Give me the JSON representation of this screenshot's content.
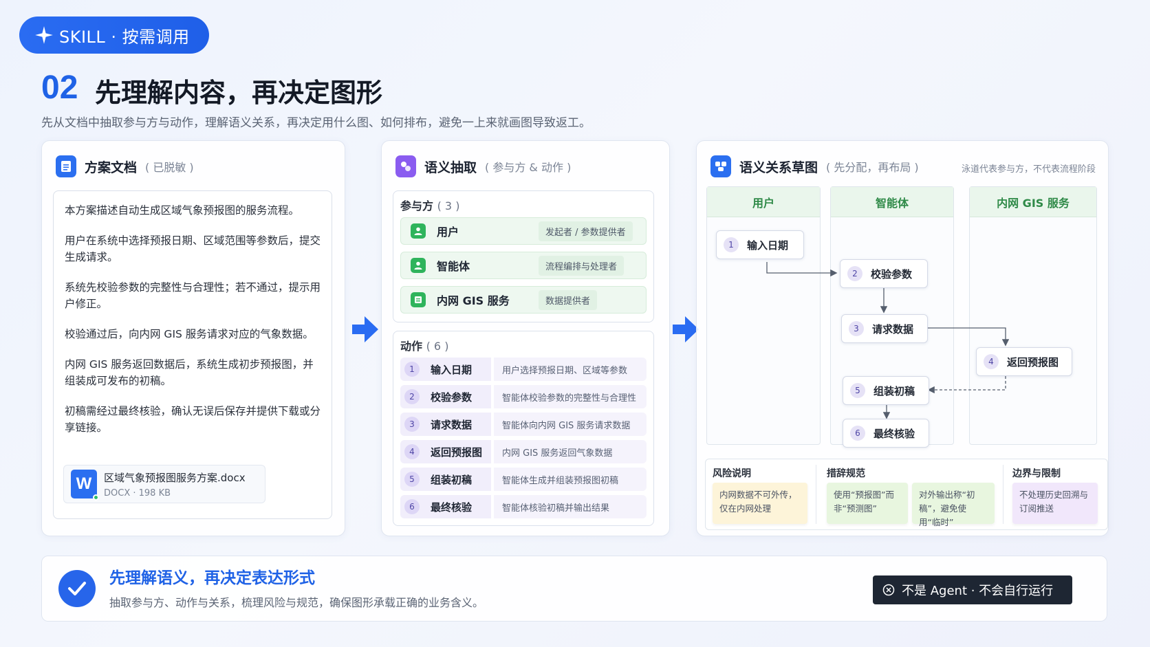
{
  "badge_top": "SKILL · 按需调用",
  "header": {
    "number": "02",
    "title": "先理解内容，再决定图形",
    "subtitle": "先从文档中抽取参与方与动作，理解语义关系，再决定用什么图、如何排布，避免一上来就画图导致返工。"
  },
  "doc_card": {
    "title": "方案文档",
    "subtitle": "( 已脱敏 )",
    "paragraphs": [
      "本方案描述自动生成区域气象预报图的服务流程。",
      "用户在系统中选择预报日期、区域范围等参数后，提交生成请求。",
      "系统先校验参数的完整性与合理性；若不通过，提示用户修正。",
      "校验通过后，向内网 GIS 服务请求对应的气象数据。",
      "内网 GIS 服务返回数据后，系统生成初步预报图，并组装成可发布的初稿。",
      "初稿需经过最终核验，确认无误后保存并提供下载或分享链接。"
    ],
    "file": {
      "icon_letter": "W",
      "name": "区域气象预报图服务方案.docx",
      "meta": "DOCX · 198 KB"
    }
  },
  "extract_card": {
    "title": "语义抽取",
    "subtitle": "( 参与方 & 动作 )",
    "parties_label": "参与方",
    "parties_count": "( 3 )",
    "parties": [
      {
        "name": "用户",
        "role": "发起者 / 参数提供者"
      },
      {
        "name": "智能体",
        "role": "流程编排与处理者"
      },
      {
        "name": "内网 GIS 服务",
        "role": "数据提供者"
      }
    ],
    "actions_label": "动作",
    "actions_count": "( 6 )",
    "actions": [
      {
        "num": "1",
        "name": "输入日期",
        "desc": "用户选择预报日期、区域等参数"
      },
      {
        "num": "2",
        "name": "校验参数",
        "desc": "智能体校验参数的完整性与合理性"
      },
      {
        "num": "3",
        "name": "请求数据",
        "desc": "智能体向内网 GIS 服务请求数据"
      },
      {
        "num": "4",
        "name": "返回预报图",
        "desc": "内网 GIS 服务返回气象数据"
      },
      {
        "num": "5",
        "name": "组装初稿",
        "desc": "智能体生成并组装预报图初稿"
      },
      {
        "num": "6",
        "name": "最终核验",
        "desc": "智能体核验初稿并输出结果"
      }
    ]
  },
  "sketch_card": {
    "title": "语义关系草图",
    "subtitle": "( 先分配，再布局 )",
    "note": "泳道代表参与方，不代表流程阶段",
    "lanes": [
      "用户",
      "智能体",
      "内网 GIS 服务"
    ],
    "nodes": [
      {
        "num": "1",
        "label": "输入日期",
        "lane": "用户"
      },
      {
        "num": "2",
        "label": "校验参数",
        "lane": "智能体"
      },
      {
        "num": "3",
        "label": "请求数据",
        "lane": "智能体"
      },
      {
        "num": "4",
        "label": "返回预报图",
        "lane": "内网 GIS 服务"
      },
      {
        "num": "5",
        "label": "组装初稿",
        "lane": "智能体"
      },
      {
        "num": "6",
        "label": "最终核验",
        "lane": "智能体"
      }
    ],
    "edges": [
      {
        "from": "1",
        "to": "2",
        "style": "solid"
      },
      {
        "from": "2",
        "to": "3",
        "style": "solid"
      },
      {
        "from": "3",
        "to": "4",
        "style": "solid"
      },
      {
        "from": "4",
        "to": "5",
        "style": "dashed"
      },
      {
        "from": "5",
        "to": "6",
        "style": "solid"
      }
    ],
    "legend": {
      "risk_title": "风险说明",
      "risk_note": "内网数据不可外传，仅在内网处理",
      "wording_title": "措辞规范",
      "wording_note_1": "使用“预报图”而非“预测图”",
      "wording_note_2": "对外输出称“初稿”，避免使用“临时”",
      "boundary_title": "边界与限制",
      "boundary_note": "不处理历史回溯与订阅推送"
    }
  },
  "bottom": {
    "title": "先理解语义，再决定表达形式",
    "subtitle": "抽取参与方、动作与关系，梳理风险与规范，确保图形承载正确的业务含义。",
    "badge": "不是 Agent · 不会自行运行"
  },
  "colors": {
    "accent": "#1f62e6",
    "lane_green": "#2f8a48",
    "dark_badge": "#1e2633"
  }
}
